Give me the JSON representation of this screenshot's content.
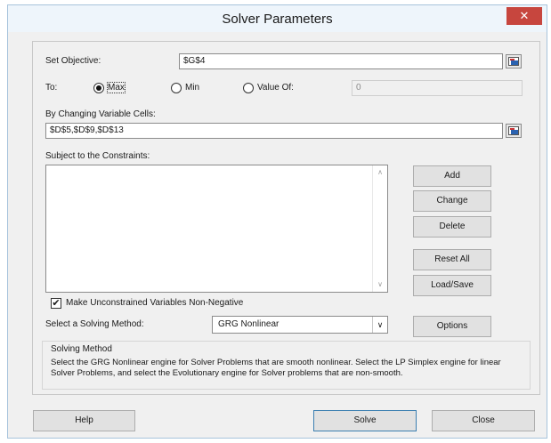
{
  "window": {
    "title": "Solver Parameters",
    "close_glyph": "✕"
  },
  "objective": {
    "label": "Set Objective:",
    "value": "$G$4"
  },
  "to": {
    "label": "To:",
    "max_label": "Max",
    "min_label": "Min",
    "value_of_label": "Value Of:",
    "value_of_field": "0",
    "selected": "Max"
  },
  "changing": {
    "label": "By Changing Variable Cells:",
    "value": "$D$5,$D$9,$D$13"
  },
  "constraints": {
    "label": "Subject to the Constraints:",
    "items": []
  },
  "constraint_buttons": {
    "add": "Add",
    "change": "Change",
    "delete": "Delete",
    "reset_all": "Reset All",
    "load_save": "Load/Save"
  },
  "nonnegative": {
    "label": "Make Unconstrained Variables Non-Negative",
    "checked": true,
    "check_glyph": "✔"
  },
  "method": {
    "label": "Select a Solving Method:",
    "selected": "GRG Nonlinear",
    "options_button": "Options"
  },
  "solving_method": {
    "heading": "Solving Method",
    "description": "Select the GRG Nonlinear engine for Solver Problems that are smooth nonlinear. Select the LP Simplex engine for linear Solver Problems, and select the Evolutionary engine for Solver problems that are non-smooth."
  },
  "footer": {
    "help": "Help",
    "solve": "Solve",
    "close": "Close"
  },
  "icons": {
    "collapse": "range-selector-icon",
    "dropdown": "chevron-down-icon",
    "scroll_up": "scroll-up-arrow-icon",
    "scroll_down": "scroll-down-arrow-icon"
  },
  "colors": {
    "close_button": "#c7463e",
    "titlebar": "#eef5fb",
    "dialog_bg": "#f0f0f0",
    "default_button_border": "#3c7fb1"
  }
}
